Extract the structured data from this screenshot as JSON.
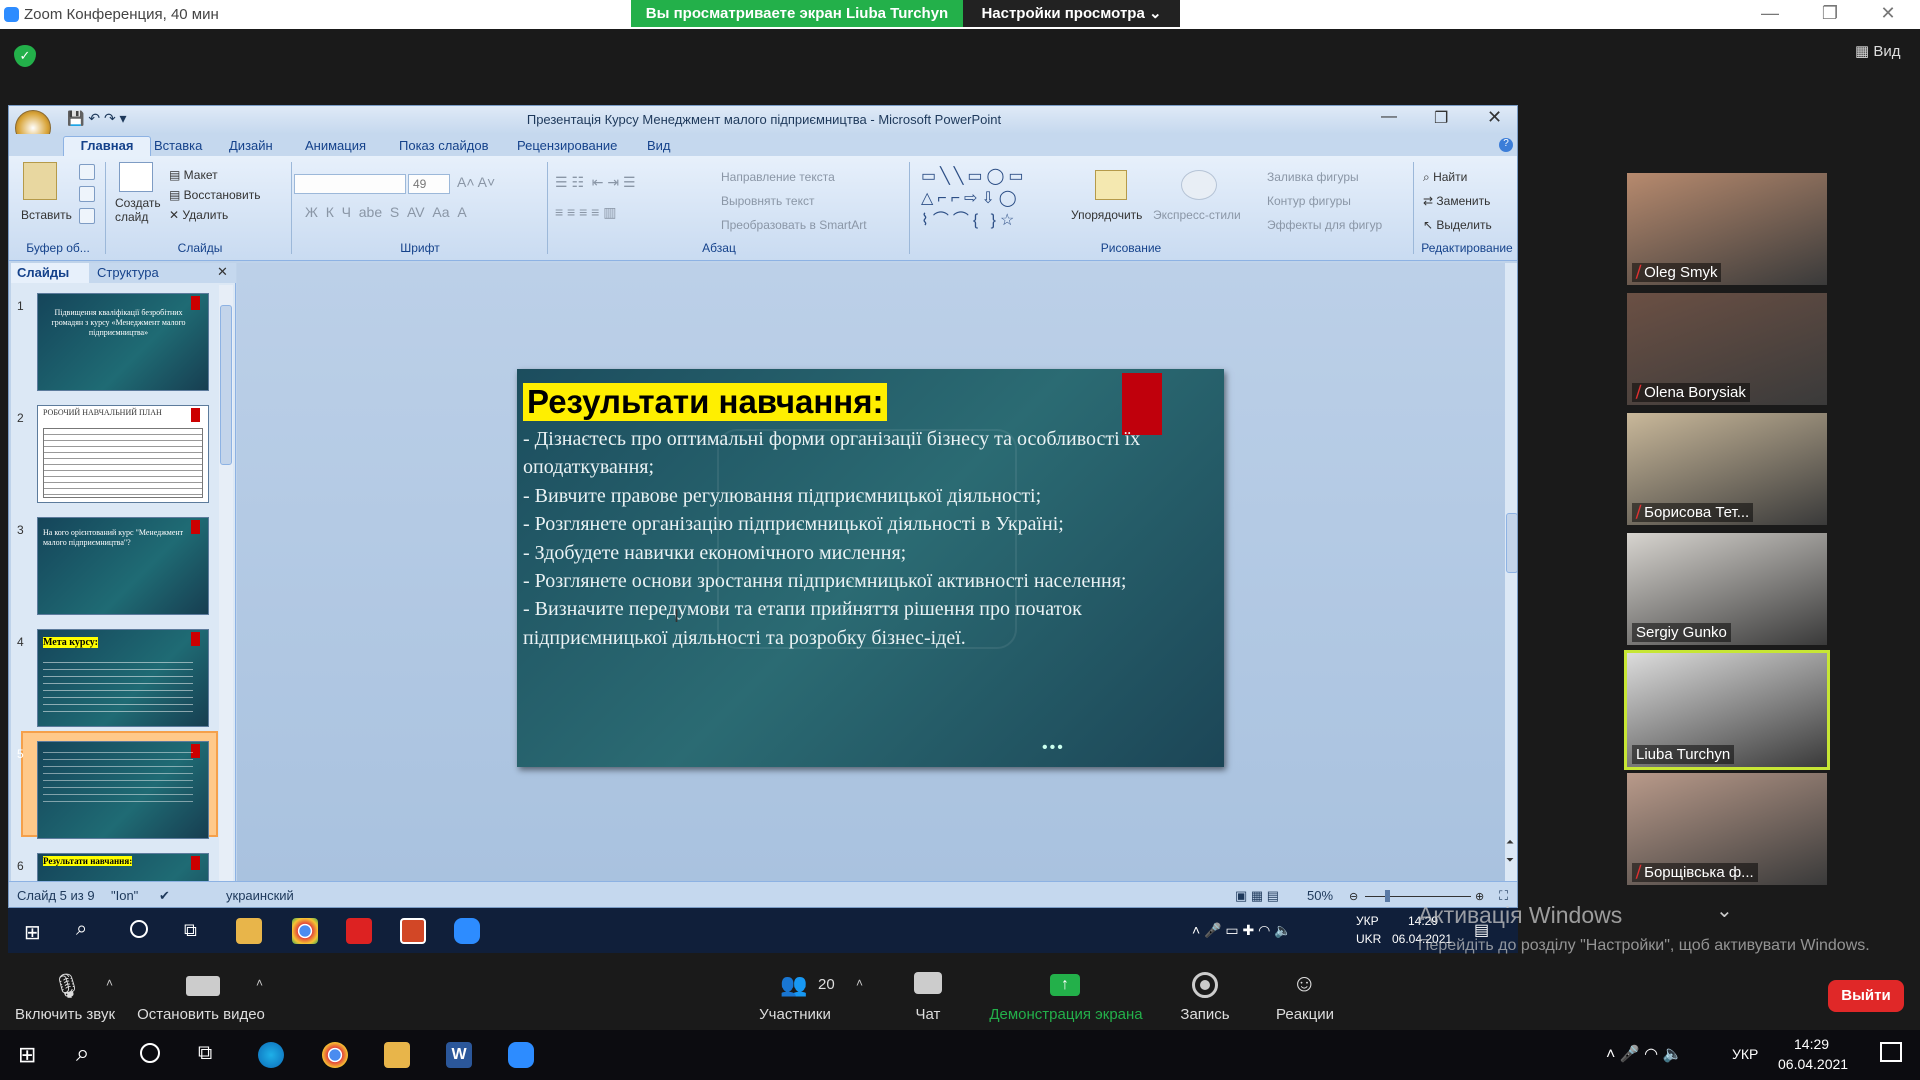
{
  "zoom": {
    "window_title": "Zoom Конференция, 40 мин",
    "share_banner": "Вы просматриваете экран Liuba Turchyn",
    "view_options": "Настройки просмотра ⌄",
    "view_button": "Вид"
  },
  "ppt": {
    "title": "Презентація Курсу Менеджмент малого підприємництва - Microsoft PowerPoint",
    "tabs": [
      "Главная",
      "Вставка",
      "Дизайн",
      "Анимация",
      "Показ слайдов",
      "Рецензирование",
      "Вид"
    ],
    "ribbon": {
      "paste": "Вставить",
      "clipboard": "Буфер об...",
      "new_slide": "Создать\nслайд",
      "layout": "Макет",
      "reset": "Восстановить",
      "delete": "Удалить",
      "slides_group": "Слайды",
      "font_size": "49",
      "font_group": "Шрифт",
      "text_dir": "Направление текста",
      "align_text": "Выровнять текст",
      "smartart": "Преобразовать в SmartArt",
      "paragraph_group": "Абзац",
      "arrange": "Упорядочить",
      "quick_styles": "Экспресс-стили",
      "fill": "Заливка фигуры",
      "outline": "Контур фигуры",
      "effects": "Эффекты для фигур",
      "drawing_group": "Рисование",
      "find": "Найти",
      "replace": "Заменить",
      "select": "Выделить",
      "editing_group": "Редактирование"
    },
    "pane_tabs": {
      "slides": "Слайды",
      "outline": "Структура"
    },
    "thumbs": [
      {
        "num": "1",
        "text": "Підвищення кваліфікації безробітних громадян з курсу «Менеджмент малого підприємництва»"
      },
      {
        "num": "2",
        "text": "РОБОЧИЙ НАВЧАЛЬНИЙ ПЛАН"
      },
      {
        "num": "3",
        "text": "На кого орієнтований курс \"Менеджмент малого підприємництва\"?"
      },
      {
        "num": "4",
        "text": "Мета курсу:"
      },
      {
        "num": "5",
        "text": ""
      },
      {
        "num": "6",
        "text": "Результати навчання:"
      }
    ],
    "slide": {
      "title": "Результати навчання:",
      "body": "- Дізнаєтесь про оптимальні форми організації бізнесу та особливості їх оподаткування;\n- Вивчите правове регулювання підприємницької діяльності;\n- Розглянете організацію підприємницької діяльності в Україні;\n- Здобудете навички економічного мислення;\n- Розглянете основи зростання підприємницької активності населення;\n- Визначите передумови та етапи прийняття рішення про початок підприємницької діяльності та розробку бізнес-ідеї."
    },
    "status": {
      "slide_of": "Слайд 5 из 9",
      "theme": "\"Ion\"",
      "lang": "украинский",
      "zoom": "50%"
    }
  },
  "inner_taskbar": {
    "lang1": "УКР",
    "lang2": "UKR",
    "time": "14:29",
    "date": "06.04.2021"
  },
  "participants": [
    {
      "name": "Oleg Smyk",
      "muted": true,
      "bg": "#b78a6e"
    },
    {
      "name": "Olena Borysiak",
      "muted": true,
      "bg": "#6b5044"
    },
    {
      "name": "Борисова Тет...",
      "muted": true,
      "bg": "#c9b89a"
    },
    {
      "name": "Sergiy Gunko",
      "muted": false,
      "bg": "#d7d4cf"
    },
    {
      "name": "Liuba Turchyn",
      "muted": false,
      "bg": "#dcdcdc"
    },
    {
      "name": "Борщівська ф...",
      "muted": true,
      "bg": "#b99a8a"
    }
  ],
  "activation": {
    "title": "Активація Windows",
    "text": "Перейдіть до розділу \"Настройки\", щоб активувати Windows."
  },
  "toolbar": {
    "unmute": "Включить звук",
    "stop_video": "Остановить видео",
    "participants": "Участники",
    "participants_count": "20",
    "chat": "Чат",
    "share": "Демонстрация экрана",
    "record": "Запись",
    "reactions": "Реакции",
    "leave": "Выйти"
  },
  "taskbar": {
    "lang": "УКР",
    "time": "14:29",
    "date": "06.04.2021"
  }
}
